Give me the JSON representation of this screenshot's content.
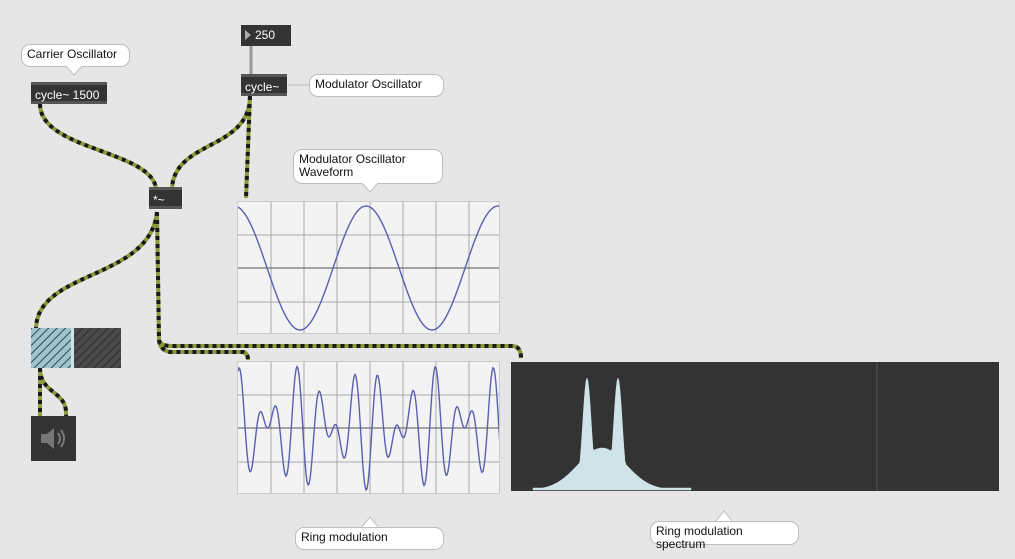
{
  "colors": {
    "background": "#e6e6e6",
    "object_bg": "#333333",
    "signal_cable": "#8a9a3a",
    "signal_cable_dash": "#1a1a1a",
    "scope_line": "#5a5fb0",
    "spectrum_fill": "#cfe3e8"
  },
  "comments": {
    "carrier": "Carrier Oscillator",
    "modulator": "Modulator Oscillator",
    "modulator_waveform": "Modulator Oscillator Waveform",
    "ring_modulation": "Ring modulation",
    "ring_spectrum": "Ring modulation spectrum"
  },
  "objects": {
    "carrier_osc": "cycle~ 1500",
    "modulator_osc": "cycle~",
    "multiplier": "*~"
  },
  "number_box": {
    "value": "250"
  },
  "icons": {
    "dac": "speaker-icon",
    "number_arrow": "triangle-right-icon"
  }
}
